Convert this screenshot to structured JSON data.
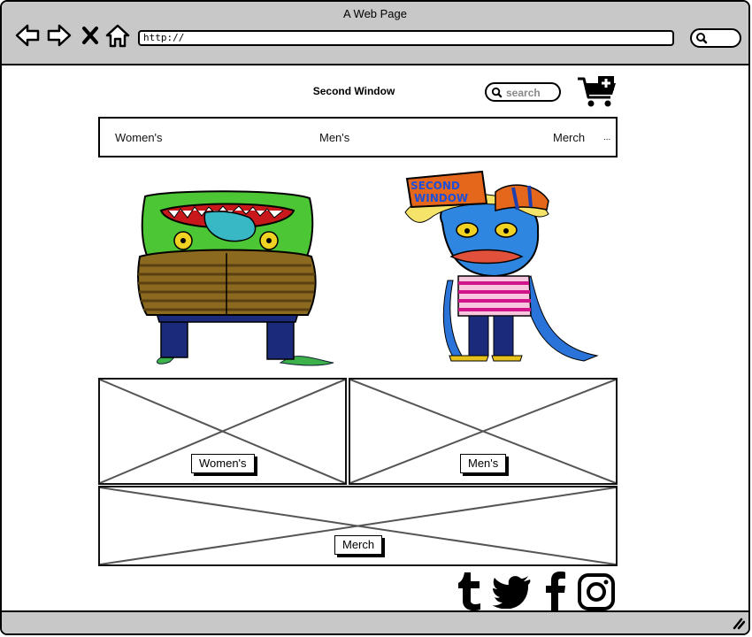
{
  "browser": {
    "title": "A Web Page",
    "url": "http://"
  },
  "site": {
    "brand": "Second Window",
    "search_placeholder": "search",
    "hat_text": [
      "SECOND",
      "WINDOW"
    ]
  },
  "nav": {
    "items": [
      "Women's",
      "Men's",
      "Merch"
    ],
    "more": "..."
  },
  "categories": {
    "womens": "Women's",
    "mens": "Men's",
    "merch": "Merch"
  },
  "social": [
    "tumblr-icon",
    "twitter-icon",
    "facebook-icon",
    "instagram-icon"
  ]
}
